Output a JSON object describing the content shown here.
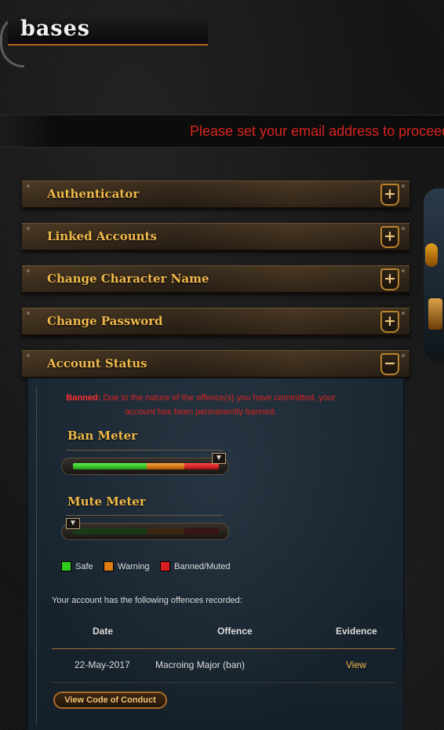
{
  "page": {
    "title": "bases"
  },
  "notice": {
    "text": "Please set your email address to proceed"
  },
  "sections": [
    {
      "label": "Authenticator",
      "toggle": "+"
    },
    {
      "label": "Linked Accounts",
      "toggle": "+"
    },
    {
      "label": "Change Character Name",
      "toggle": "+"
    },
    {
      "label": "Change Password",
      "toggle": "+"
    },
    {
      "label": "Account Status",
      "toggle": "−"
    }
  ],
  "account_status": {
    "ban_label": "Banned:",
    "ban_message_line1": "Due to the nature of the offence(s) you have committed, your",
    "ban_message_line2": "account has been permanently banned.",
    "ban_meter": {
      "title": "Ban Meter",
      "level": 1.0
    },
    "mute_meter": {
      "title": "Mute Meter",
      "level": 0.0
    },
    "legend": [
      {
        "label": "Safe",
        "color": "#2ecc1f"
      },
      {
        "label": "Warning",
        "color": "#e07c12"
      },
      {
        "label": "Banned/Muted",
        "color": "#d81f1f"
      }
    ],
    "offences_intro": "Your account has the following offences recorded:",
    "table": {
      "headers": {
        "date": "Date",
        "offence": "Offence",
        "evidence": "Evidence"
      },
      "rows": [
        {
          "date": "22-May-2017",
          "offence": "Macroing Major (ban)",
          "evidence": "View"
        }
      ]
    },
    "conduct_button": "View Code of Conduct"
  },
  "colors": {
    "accent": "#f0b94a",
    "alert": "#d9231f",
    "safe": "#2ecc1f",
    "warning": "#e07c12",
    "banned": "#d81f1f"
  },
  "icons": {
    "expand": "plus-icon",
    "collapse": "minus-icon",
    "marker": "triangle-down-icon"
  }
}
